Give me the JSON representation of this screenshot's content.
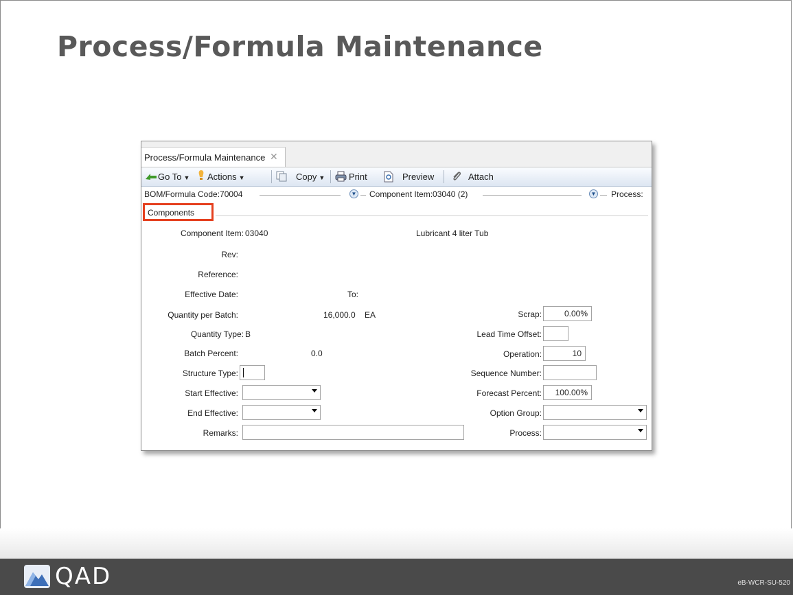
{
  "slide": {
    "title": "Process/Formula Maintenance",
    "footer_code": "eB-WCR-SU-520"
  },
  "logo": {
    "text": "QAD"
  },
  "window": {
    "tab_label": "Process/Formula Maintenance",
    "toolbar": {
      "goto": "Go To",
      "actions": "Actions",
      "copy": "Copy",
      "print": "Print",
      "preview": "Preview",
      "attach": "Attach"
    },
    "breadcrumbs": {
      "bom": "BOM/Formula Code:70004",
      "component": "Component Item:03040 (2)",
      "process": "Process:"
    },
    "section": "Components"
  },
  "form": {
    "component_item_label": "Component Item:",
    "component_item_value": "03040",
    "component_description": "Lubricant 4 liter Tub",
    "rev_label": "Rev:",
    "reference_label": "Reference:",
    "effective_date_label": "Effective Date:",
    "to_label": "To:",
    "qty_per_batch_label": "Quantity per Batch:",
    "qty_per_batch_value": "16,000.0",
    "qty_uom": "EA",
    "qty_type_label": "Quantity Type:",
    "qty_type_value": "B",
    "batch_percent_label": "Batch Percent:",
    "batch_percent_value": "0.0",
    "structure_type_label": "Structure Type:",
    "start_effective_label": "Start Effective:",
    "end_effective_label": "End Effective:",
    "remarks_label": "Remarks:",
    "scrap_label": "Scrap:",
    "scrap_value": "0.00%",
    "lead_time_offset_label": "Lead Time Offset:",
    "operation_label": "Operation:",
    "operation_value": "10",
    "sequence_number_label": "Sequence Number:",
    "forecast_percent_label": "Forecast Percent:",
    "forecast_percent_value": "100.00%",
    "option_group_label": "Option Group:",
    "process_label": "Process:"
  },
  "colors": {
    "title": "#595959",
    "highlight_box": "#e5401f",
    "footer_bar": "#4a4a4a",
    "logo_blue": "#5b8fd6"
  }
}
